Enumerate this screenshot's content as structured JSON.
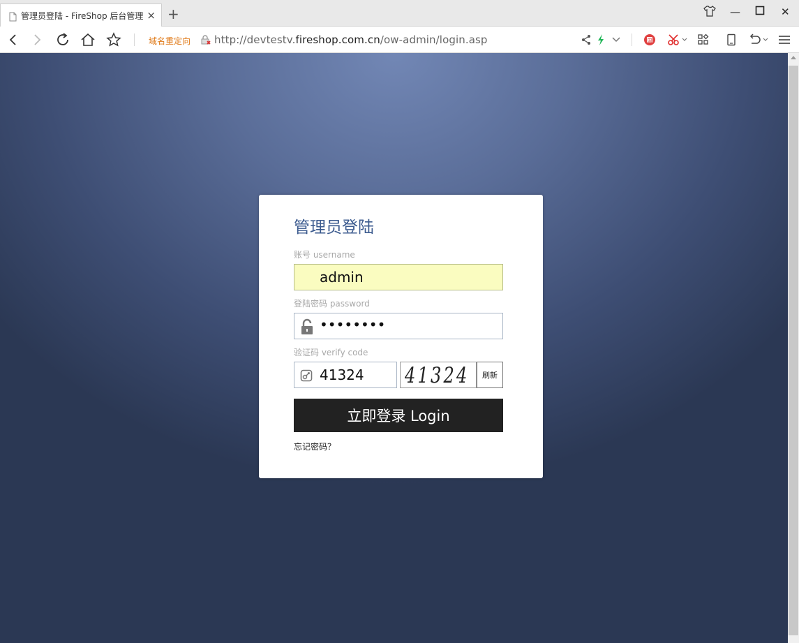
{
  "browser": {
    "tab_title": "管理员登陆 - FireShop 后台管理",
    "tab_close": "×",
    "new_tab": "+",
    "redirect_label": "域名重定向",
    "url_prefix": "http://devtestv.",
    "url_domain": "fireshop.com.cn",
    "url_path": "/ow-admin/login.asp",
    "window_controls": {
      "minimize": "—",
      "maximize": "☐",
      "close": "✕"
    }
  },
  "login": {
    "title": "管理员登陆",
    "username_label": "账号 username",
    "username_value": "admin",
    "password_label": "登陆密码 password",
    "password_value": "••••••••",
    "code_label": "验证码 verify code",
    "code_value": "41324",
    "captcha_text": "41324",
    "refresh_label": "刷新",
    "submit_label": "立即登录 Login",
    "forgot_label": "忘记密码？"
  },
  "colors": {
    "accent_title": "#3c5b8f",
    "username_bg": "#fafcc0",
    "button_bg": "#222222",
    "redirect_text": "#e07b1a"
  }
}
